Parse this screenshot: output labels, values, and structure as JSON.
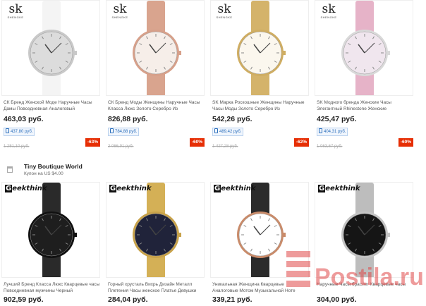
{
  "row1": [
    {
      "brand": "sk",
      "title": "СК Бренд Женской Моде Наручные Часы Дамы Повседневная Аналоговый",
      "price": "463,03 руб.",
      "coupon_price": "437,80 руб.",
      "old_price": "1 251,10 руб.",
      "discount": "-63%",
      "face": "#dcdcdc",
      "strap": "#f4f4f4",
      "case": "#c9c9c9"
    },
    {
      "brand": "sk",
      "title": "СК Бренд Моды Женщины Наручные Часы Класса Люкс Золото Серебро Из",
      "price": "826,88 руб.",
      "coupon_price": "784,88 руб.",
      "old_price": "2 066,91 руб.",
      "discount": "-60%",
      "face": "#f6eee9",
      "strap": "#d9a48e",
      "case": "#d7a08a"
    },
    {
      "brand": "sk",
      "title": "SK Марка Роскошные Женщины Наручные Часы Моды Золото Серебро Из",
      "price": "542,26 руб.",
      "coupon_price": "489,42 руб.",
      "old_price": "1 427,28 руб.",
      "discount": "-62%",
      "face": "#fbf7ee",
      "strap": "#d4b36a",
      "case": "#cfad62"
    },
    {
      "brand": "sk",
      "title": "SK Модного бренда Женские Часы Элегантный Rhinestone Женские",
      "price": "425,47 руб.",
      "coupon_price": "404,31 руб.",
      "old_price": "1 063,67 руб.",
      "discount": "-60%",
      "face": "#f0e6ee",
      "strap": "#e6b3c8",
      "case": "#d9d9d9"
    }
  ],
  "store": {
    "name": "Tiny Boutique World",
    "coupon": "Купон на US $4.00"
  },
  "row2": [
    {
      "brand": "Geekthink",
      "title": "Лучший Бренд Класса Люкс Кварцевые часы Повседневная мужчины Черный",
      "price": "902,59 руб.",
      "face": "#1e1e1e",
      "strap": "#2a2a2a",
      "case": "#111111"
    },
    {
      "brand": "Geekthink",
      "title": "Горный хрусталь Вихрь Дизайн Металл Плетения Часы женское Платье Девушки",
      "price": "284,04 руб.",
      "face": "#20233a",
      "strap": "#d4b056",
      "case": "#c8a24a"
    },
    {
      "brand": "Geekthink",
      "title": "Уникальная Женщина Кварцевые Аналоговые Мотом Музыкальной Ноте",
      "price": "339,21 руб.",
      "face": "#ffffff",
      "strap": "#2b2b2b",
      "case": "#c98b6a"
    },
    {
      "brand": "Geekthink",
      "title": "Наручные Часы браслет Кварцевые часы",
      "price": "304,00 руб.",
      "face": "#151515",
      "strap": "#bdbdbd",
      "case": "#c4c4c4"
    }
  ],
  "watermark": {
    "text": "Postila.ru",
    "color": "#e14a4a"
  }
}
